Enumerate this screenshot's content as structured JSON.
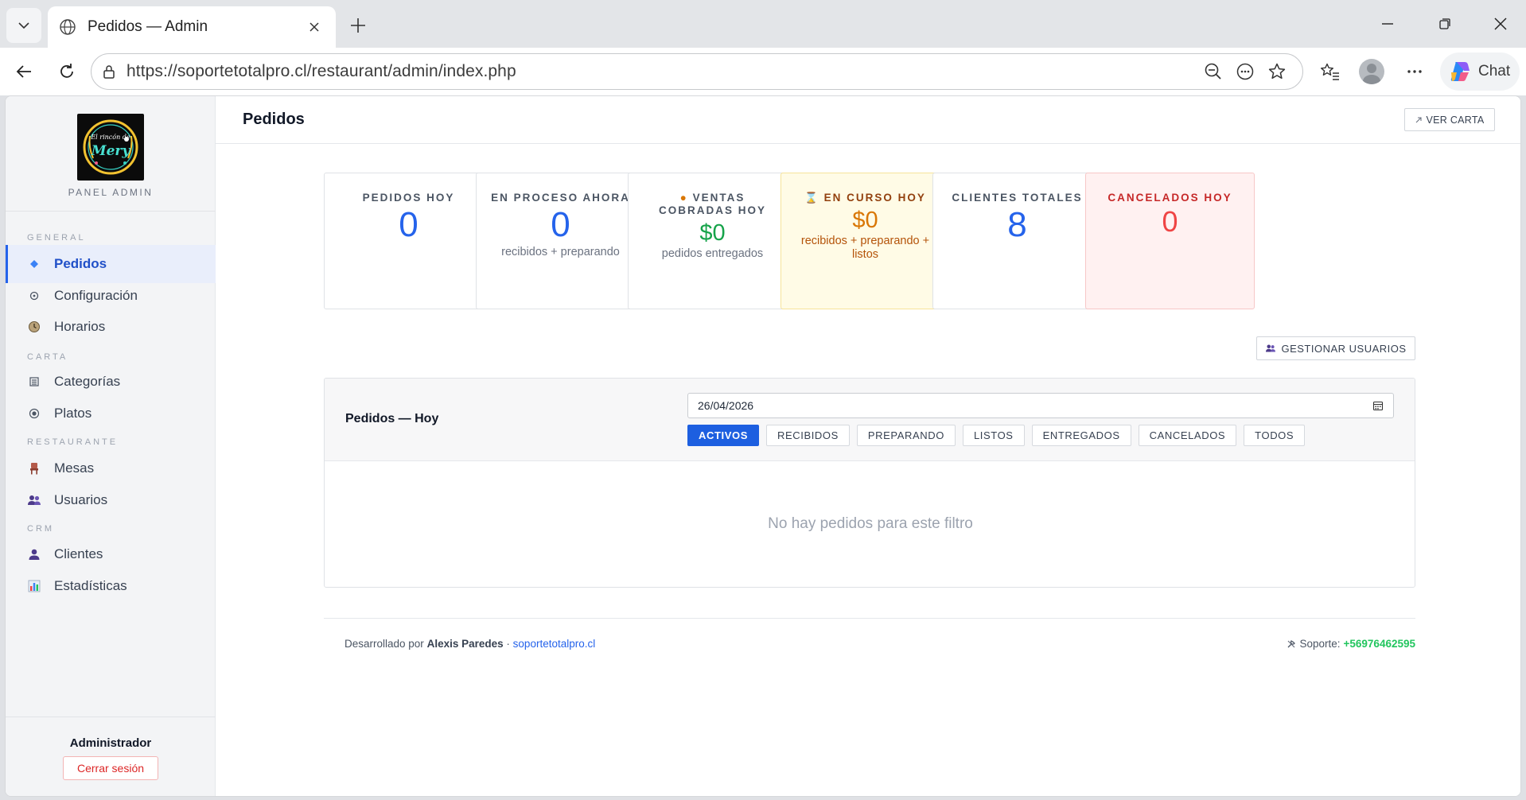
{
  "browser": {
    "tab_title": "Pedidos — Admin",
    "url": "https://soportetotalpro.cl/restaurant/admin/index.php",
    "chat_label": "Chat"
  },
  "sidebar": {
    "logo_text": "El rincón de Mery",
    "panel_label": "PANEL ADMIN",
    "groups": {
      "general": "GENERAL",
      "carta": "CARTA",
      "restaurante": "RESTAURANTE",
      "crm": "CRM"
    },
    "items": {
      "pedidos": "Pedidos",
      "configuracion": "Configuración",
      "horarios": "Horarios",
      "categorias": "Categorías",
      "platos": "Platos",
      "mesas": "Mesas",
      "usuarios": "Usuarios",
      "clientes": "Clientes",
      "estadisticas": "Estadísticas"
    },
    "admin_name": "Administrador",
    "logout_label": "Cerrar sesión"
  },
  "header": {
    "title": "Pedidos",
    "ver_carta": "VER CARTA"
  },
  "stats": {
    "pedidos_hoy": {
      "label": "PEDIDOS HOY",
      "value": "0"
    },
    "en_proceso": {
      "label": "EN PROCESO AHORA",
      "value": "0",
      "sub": "recibidos + preparando"
    },
    "ventas": {
      "label": "VENTAS COBRADAS HOY",
      "value": "$0",
      "sub": "pedidos entregados"
    },
    "en_curso": {
      "label": "EN CURSO HOY",
      "value": "$0",
      "sub": "recibidos + preparando + listos"
    },
    "clientes": {
      "label": "CLIENTES TOTALES",
      "value": "8"
    },
    "cancelados": {
      "label": "CANCELADOS HOY",
      "value": "0"
    }
  },
  "manage_users": "GESTIONAR USUARIOS",
  "orders": {
    "title": "Pedidos — Hoy",
    "date": "26/04/2026",
    "filters": {
      "activos": "ACTIVOS",
      "recibidos": "RECIBIDOS",
      "preparando": "PREPARANDO",
      "listos": "LISTOS",
      "entregados": "ENTREGADOS",
      "cancelados": "CANCELADOS",
      "todos": "TODOS"
    },
    "empty": "No hay pedidos para este filtro"
  },
  "footer": {
    "dev_prefix": "Desarrollado por",
    "dev_name": "Alexis Paredes",
    "dev_sep": "·",
    "dev_link": "soportetotalpro.cl",
    "support_label": "Soporte:",
    "support_phone": "+56976462595"
  },
  "colors": {
    "primary": "#2563eb",
    "success": "#16a34a",
    "warning": "#d97706",
    "danger": "#ef4444"
  }
}
